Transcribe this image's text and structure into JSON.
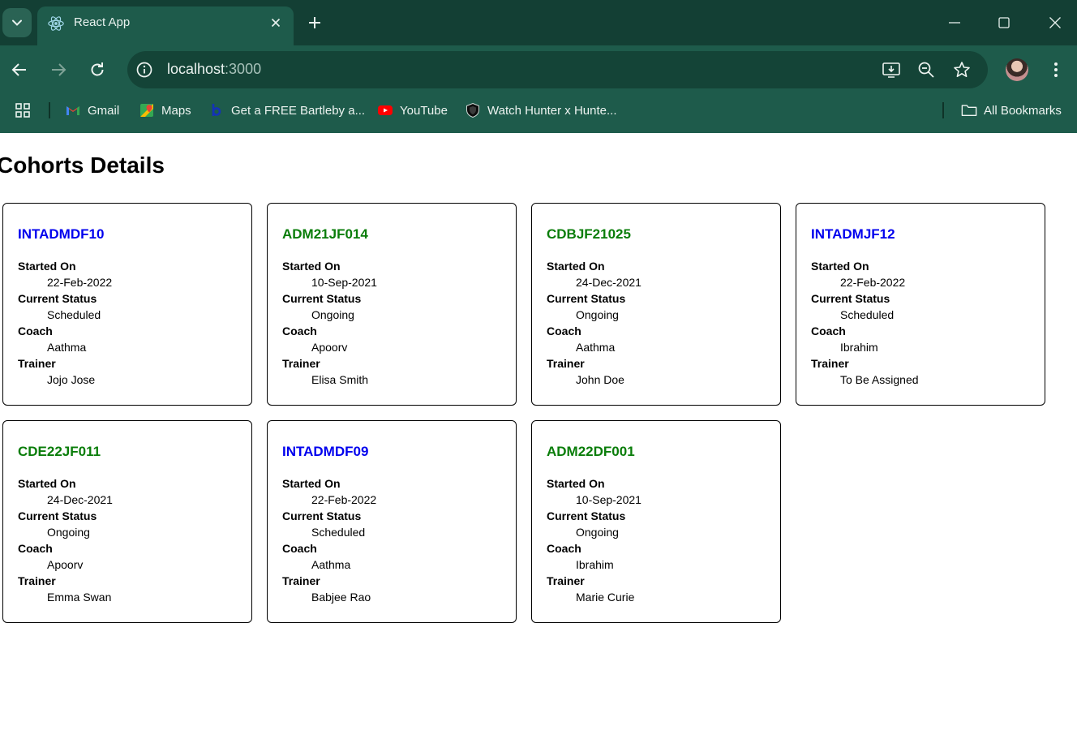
{
  "browser": {
    "tab_title": "React App",
    "url_host": "localhost",
    "url_port": ":3000",
    "bookmarks": [
      {
        "label": "Gmail",
        "icon": "gmail-icon"
      },
      {
        "label": "Maps",
        "icon": "maps-icon"
      },
      {
        "label": "Get a FREE Bartleby a...",
        "icon": "bartleby-icon"
      },
      {
        "label": "YouTube",
        "icon": "youtube-icon"
      },
      {
        "label": "Watch Hunter x Hunte...",
        "icon": "shield-icon"
      }
    ],
    "all_bookmarks_label": "All Bookmarks",
    "colors": {
      "frame": "#133f34",
      "toolbar": "#1e5b4b",
      "omnibox": "#144437"
    }
  },
  "page": {
    "title": "Cohorts Details",
    "field_labels": {
      "started_on": "Started On",
      "current_status": "Current Status",
      "coach": "Coach",
      "trainer": "Trainer"
    },
    "cohorts": [
      {
        "code": "INTADMDF10",
        "started_on": "22-Feb-2022",
        "status": "Scheduled",
        "coach": "Aathma",
        "trainer": "Jojo Jose",
        "code_color": "blue"
      },
      {
        "code": "ADM21JF014",
        "started_on": "10-Sep-2021",
        "status": "Ongoing",
        "coach": "Apoorv",
        "trainer": "Elisa Smith",
        "code_color": "green"
      },
      {
        "code": "CDBJF21025",
        "started_on": "24-Dec-2021",
        "status": "Ongoing",
        "coach": "Aathma",
        "trainer": "John Doe",
        "code_color": "green"
      },
      {
        "code": "INTADMJF12",
        "started_on": "22-Feb-2022",
        "status": "Scheduled",
        "coach": "Ibrahim",
        "trainer": "To Be Assigned",
        "code_color": "blue"
      },
      {
        "code": "CDE22JF011",
        "started_on": "24-Dec-2021",
        "status": "Ongoing",
        "coach": "Apoorv",
        "trainer": "Emma Swan",
        "code_color": "green"
      },
      {
        "code": "INTADMDF09",
        "started_on": "22-Feb-2022",
        "status": "Scheduled",
        "coach": "Aathma",
        "trainer": "Babjee Rao",
        "code_color": "blue"
      },
      {
        "code": "ADM22DF001",
        "started_on": "10-Sep-2021",
        "status": "Ongoing",
        "coach": "Ibrahim",
        "trainer": "Marie Curie",
        "code_color": "green"
      }
    ],
    "colors": {
      "scheduled_code": "#0000ee",
      "ongoing_code": "#0a7d0a"
    }
  }
}
